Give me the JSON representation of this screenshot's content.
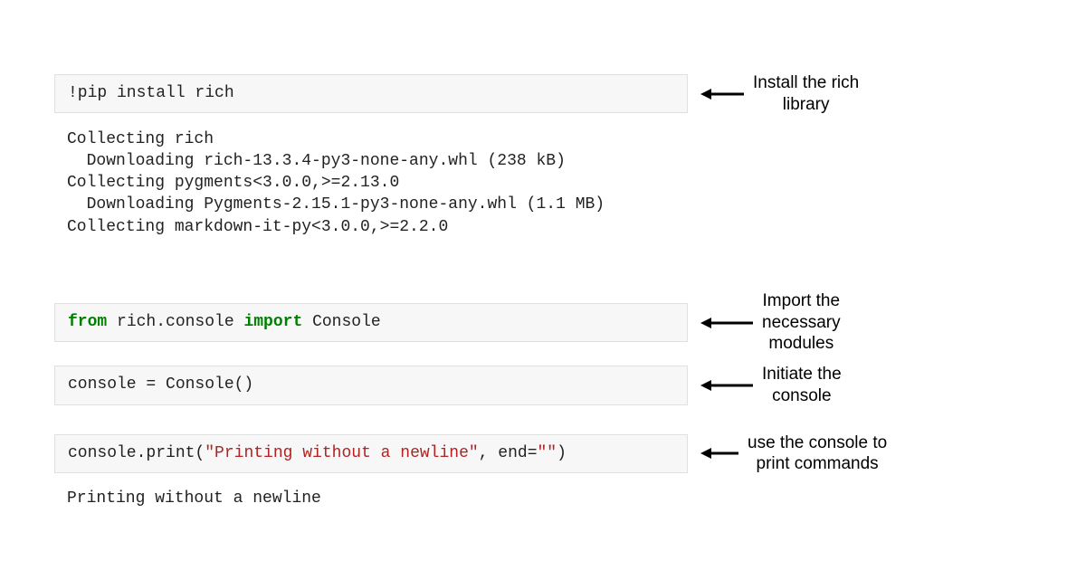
{
  "cell1": {
    "code": "!pip install rich",
    "annotation": "Install the rich\nlibrary",
    "output": "Collecting rich\n  Downloading rich-13.3.4-py3-none-any.whl (238 kB)\nCollecting pygments<3.0.0,>=2.13.0\n  Downloading Pygments-2.15.1-py3-none-any.whl (1.1 MB)\nCollecting markdown-it-py<3.0.0,>=2.2.0"
  },
  "cell2": {
    "kw_from": "from",
    "mod": " rich.console ",
    "kw_import": "import",
    "name": " Console",
    "annotation": "Import the\nnecessary\nmodules"
  },
  "cell3": {
    "code": "console = Console()",
    "annotation": "Initiate the\nconsole"
  },
  "cell4": {
    "prefix": "console.print(",
    "str": "\"Printing without a newline\"",
    "mid": ", end=",
    "str2": "\"\"",
    "suffix": ")",
    "annotation": "use the console to\nprint commands",
    "output": "Printing without a newline"
  }
}
